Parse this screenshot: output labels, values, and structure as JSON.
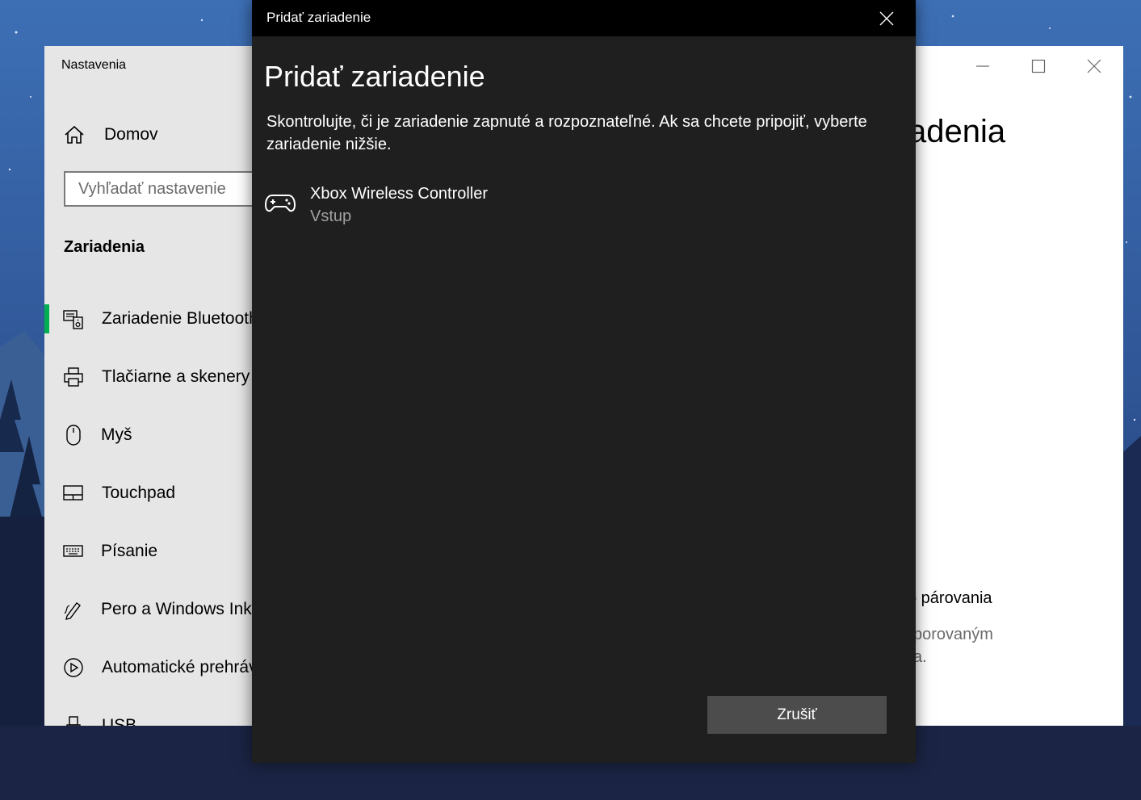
{
  "colors": {
    "accent": "#00b050",
    "dialog_bg": "#1f1f1f",
    "titlebar_bg": "#000000",
    "sidebar_bg": "#e6e6e6",
    "button_bg": "#4c4c4c"
  },
  "settings": {
    "app_title": "Nastavenia",
    "home": {
      "label": "Domov",
      "icon": "home-icon"
    },
    "search": {
      "placeholder": "Vyhľadať nastavenie"
    },
    "section_title": "Zariadenia",
    "nav": [
      {
        "label": "Zariadenie Bluetooth",
        "icon": "bluetooth-devices-icon",
        "active": true
      },
      {
        "label": "Tlačiarne a skenery",
        "icon": "printer-icon"
      },
      {
        "label": "Myš",
        "icon": "mouse-icon"
      },
      {
        "label": "Touchpad",
        "icon": "touchpad-icon"
      },
      {
        "label": "Písanie",
        "icon": "keyboard-icon"
      },
      {
        "label": "Pero a Windows Ink",
        "icon": "pen-icon"
      },
      {
        "label": "Automatické prehrávanie",
        "icon": "autoplay-icon"
      },
      {
        "label": "USB",
        "icon": "usb-icon"
      }
    ],
    "page_title_visible": "adenia",
    "pairing_heading_visible": "o párovania",
    "pairing_text_lines_visible": [
      "porovaným",
      "a."
    ]
  },
  "dialog": {
    "titlebar": "Pridať zariadenie",
    "heading": "Pridať zariadenie",
    "description": "Skontrolujte, či je zariadenie zapnuté a rozpoznateľné. Ak sa chcete pripojiť, vyberte zariadenie nižšie.",
    "devices": [
      {
        "name": "Xbox Wireless Controller",
        "type": "Vstup",
        "icon": "gamepad-icon"
      }
    ],
    "cancel_label": "Zrušiť"
  }
}
